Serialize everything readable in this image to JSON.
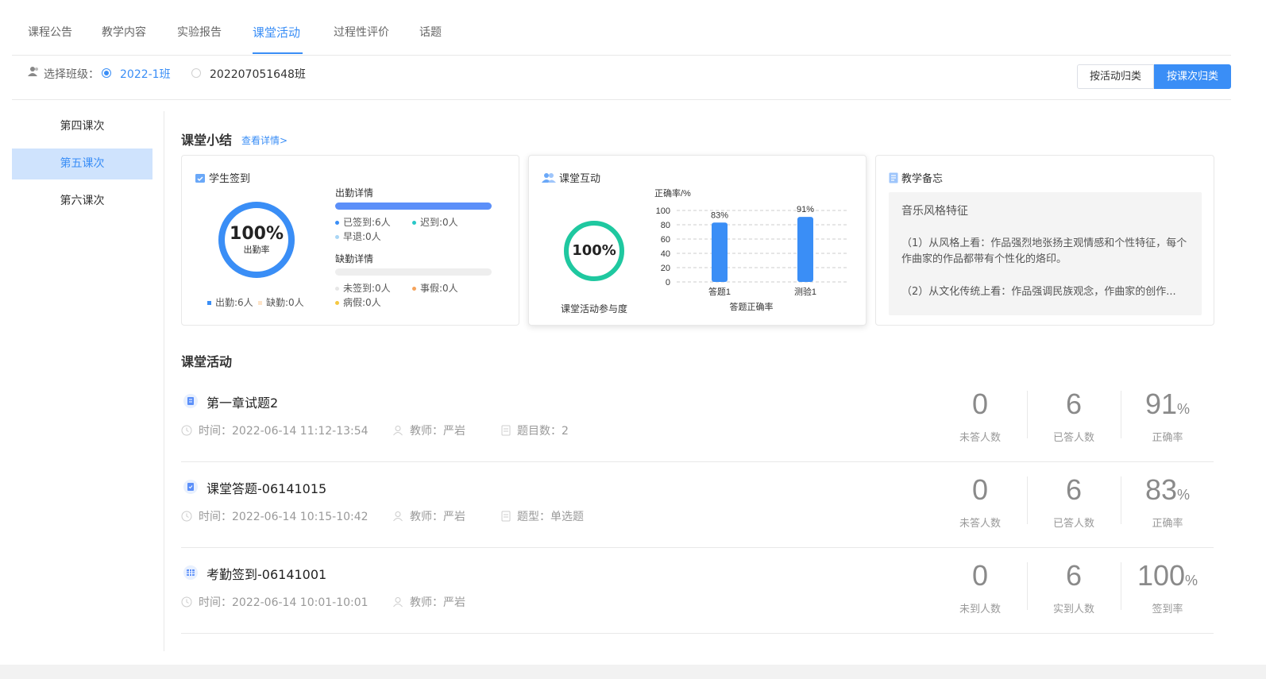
{
  "tabs": [
    "课程公告",
    "教学内容",
    "实验报告",
    "课堂活动",
    "过程性评价",
    "话题"
  ],
  "class_select": {
    "label": "选择班级：",
    "options": [
      "2022-1班",
      "202207051648班"
    ],
    "selected": "2022-1班"
  },
  "group_buttons": [
    "按活动归类",
    "按课次归类"
  ],
  "group_active": "按课次归类",
  "sidebar": [
    "第四课次",
    "第五课次",
    "第六课次"
  ],
  "sidebar_active": "第五课次",
  "summary": {
    "title": "课堂小结",
    "detail_link": "查看详情>",
    "attendance": {
      "title": "学生签到",
      "rate_value": "100%",
      "rate_label": "出勤率",
      "rate": 1.0,
      "legend": [
        "出勤:6人",
        "缺勤:0人"
      ],
      "present_detail_title": "出勤详情",
      "present_fill": 1.0,
      "present_items": [
        "已签到:6人",
        "迟到:0人",
        "早退:0人"
      ],
      "absent_detail_title": "缺勤详情",
      "absent_fill": 0,
      "absent_items": [
        "未签到:0人",
        "事假:0人",
        "病假:0人"
      ]
    },
    "interaction": {
      "title": "课堂互动",
      "participation_value": "100%",
      "participation": 1.0,
      "participation_label": "课堂活动参与度",
      "chart_caption": "答题正确率"
    },
    "memo": {
      "title": "教学备忘",
      "lines": [
        "音乐风格特征",
        "（1）从风格上看：作品强烈地张扬主观情感和个性特征，每个作曲家的作品都带有个性化的烙印。",
        "（2）从文化传统上看：作品强调民族观念，作曲家的创作..."
      ]
    }
  },
  "chart_data": {
    "type": "bar",
    "title": "",
    "ylabel": "正确率/%",
    "xlabel": "答题正确率",
    "categories": [
      "答题1",
      "测验1"
    ],
    "values": [
      83,
      91
    ],
    "data_labels": [
      "83%",
      "91%"
    ],
    "yticks": [
      0,
      20,
      40,
      60,
      80,
      100
    ],
    "ylim": [
      0,
      100
    ],
    "grid": true,
    "color": "#3a8ef6"
  },
  "activities_title": "课堂活动",
  "activities": [
    {
      "title": "第一章试题2",
      "time": "时间：2022-06-14 11:12-13:54",
      "teacher": "教师：严岩",
      "extra": "题目数：2",
      "stats": [
        {
          "num": "0",
          "pct": "",
          "label": "未答人数"
        },
        {
          "num": "6",
          "pct": "",
          "label": "已答人数"
        },
        {
          "num": "91",
          "pct": "%",
          "label": "正确率"
        }
      ]
    },
    {
      "title": "课堂答题-06141015",
      "time": "时间：2022-06-14 10:15-10:42",
      "teacher": "教师：严岩",
      "extra": "题型：单选题",
      "stats": [
        {
          "num": "0",
          "pct": "",
          "label": "未答人数"
        },
        {
          "num": "6",
          "pct": "",
          "label": "已答人数"
        },
        {
          "num": "83",
          "pct": "%",
          "label": "正确率"
        }
      ]
    },
    {
      "title": "考勤签到-06141001",
      "time": "时间：2022-06-14 10:01-10:01",
      "teacher": "教师：严岩",
      "extra": "",
      "stats": [
        {
          "num": "0",
          "pct": "",
          "label": "未到人数"
        },
        {
          "num": "6",
          "pct": "",
          "label": "实到人数"
        },
        {
          "num": "100",
          "pct": "%",
          "label": "签到率"
        }
      ]
    }
  ],
  "colors": {
    "accent": "#3a8ef6",
    "teal": "#1fc8a0",
    "cyan": "#29c7c7",
    "orange": "#f5a35c",
    "yellow": "#f5c842",
    "light_blue": "#a9d6f5"
  }
}
